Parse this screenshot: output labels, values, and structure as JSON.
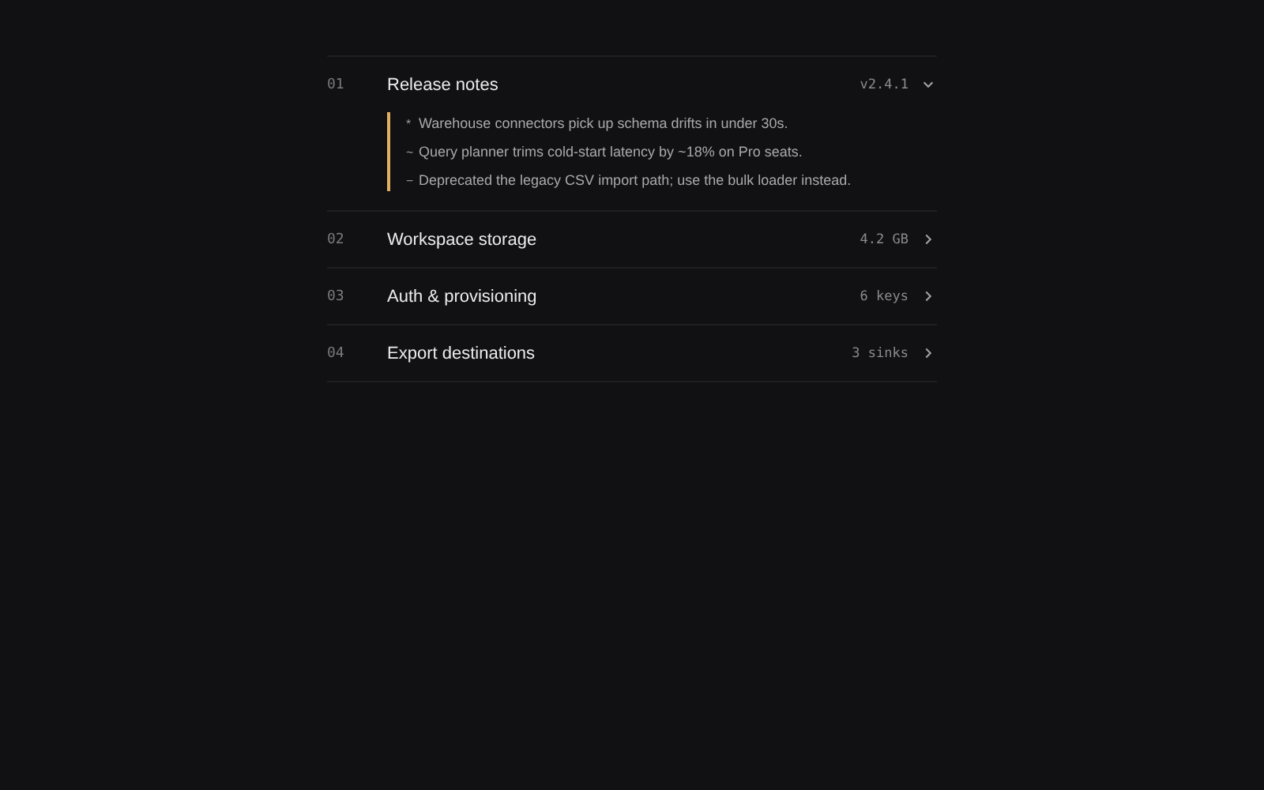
{
  "sections": [
    {
      "number": "01",
      "title": "Release notes",
      "meta": "v2.4.1",
      "expanded": true,
      "notes": [
        {
          "marker": "*",
          "text": "Warehouse connectors pick up schema drifts in under 30s."
        },
        {
          "marker": "~",
          "text": "Query planner trims cold-start latency by ~18% on Pro seats."
        },
        {
          "marker": "−",
          "text": "Deprecated the legacy CSV import path; use the bulk loader instead."
        }
      ]
    },
    {
      "number": "02",
      "title": "Workspace storage",
      "meta": "4.2 GB",
      "expanded": false
    },
    {
      "number": "03",
      "title": "Auth & provisioning",
      "meta": "6 keys",
      "expanded": false
    },
    {
      "number": "04",
      "title": "Export destinations",
      "meta": "3 sinks",
      "expanded": false
    }
  ]
}
